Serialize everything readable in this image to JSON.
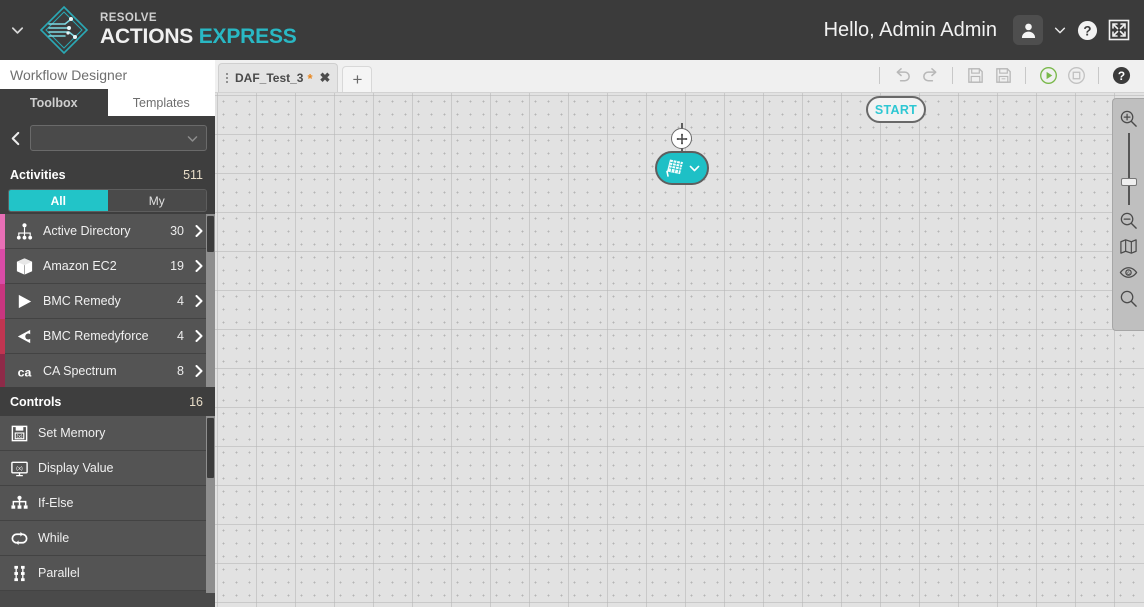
{
  "header": {
    "caret_icon": "chevron-down-icon",
    "brand": {
      "mark_icon": "resolve-diamond-logo",
      "line1": "RESOLVE",
      "line2_a": "ACTIONS",
      "line2_b": "EXPRESS"
    },
    "greeting": "Hello, Admin Admin",
    "avatar_icon": "user-icon",
    "avatar_caret_icon": "chevron-down-icon",
    "help_icon": "help-circle-icon",
    "fullscreen_icon": "fullscreen-expand-icon",
    "bg_color": "#3b3b3b",
    "accent_color": "#29b8c4"
  },
  "left_panel": {
    "title": "Workflow Designer",
    "tabs": [
      {
        "label": "Toolbox",
        "active": true
      },
      {
        "label": "Templates",
        "active": false
      }
    ],
    "collapse_icon": "chevron-left-icon",
    "search": {
      "value": "",
      "placeholder": "",
      "chevron_icon": "chevron-down-icon"
    },
    "activities_section": {
      "title": "Activities",
      "count": "511",
      "filters": [
        {
          "label": "All",
          "selected": true
        },
        {
          "label": "My",
          "selected": false
        }
      ],
      "items": [
        {
          "label": "Active Directory",
          "count": "30",
          "icon": "active-directory-icon",
          "swatch": "#e86fb6",
          "arrow_icon": "chevron-right-icon"
        },
        {
          "label": "Amazon EC2",
          "count": "19",
          "icon": "amazon-ec2-box-icon",
          "swatch": "#d94ba6",
          "arrow_icon": "chevron-right-icon"
        },
        {
          "label": "BMC Remedy",
          "count": "4",
          "icon": "bmc-remedy-play-icon",
          "swatch": "#c9357f",
          "arrow_icon": "chevron-right-icon"
        },
        {
          "label": "BMC Remedyforce",
          "count": "4",
          "icon": "bmc-remedyforce-icon",
          "swatch": "#c03551",
          "arrow_icon": "chevron-right-icon"
        },
        {
          "label": "CA Spectrum",
          "count": "8",
          "icon": "ca-spectrum-icon",
          "swatch": "#8e2a48",
          "arrow_icon": "chevron-right-icon"
        }
      ]
    },
    "controls_section": {
      "title": "Controls",
      "count": "16",
      "items": [
        {
          "label": "Set Memory",
          "icon": "set-memory-icon"
        },
        {
          "label": "Display Value",
          "icon": "display-value-icon"
        },
        {
          "label": "If-Else",
          "icon": "if-else-icon"
        },
        {
          "label": "While",
          "icon": "while-loop-icon"
        },
        {
          "label": "Parallel",
          "icon": "parallel-icon"
        }
      ]
    }
  },
  "topbar": {
    "document_tab": {
      "grip_icon": "drag-handle-icon",
      "name": "DAF_Test_3",
      "dirty_marker": "*",
      "close_icon": "close-icon",
      "close_glyph": "✖"
    },
    "new_tab_label": "+",
    "toolbar_buttons": [
      {
        "name": "undo-button",
        "icon": "undo-arrow-icon"
      },
      {
        "name": "redo-button",
        "icon": "redo-arrow-icon"
      },
      {
        "name": "save-button",
        "icon": "save-floppy-icon"
      },
      {
        "name": "save-as-button",
        "icon": "save-as-floppy-icon"
      },
      {
        "name": "run-button",
        "icon": "play-circle-icon"
      },
      {
        "name": "stop-button",
        "icon": "stop-circle-icon"
      },
      {
        "name": "help-button",
        "icon": "help-circle-icon"
      }
    ]
  },
  "canvas": {
    "start_node_label": "START",
    "start_node_text_color": "#2ec7d3",
    "add_node_icon": "add-node-icon",
    "activity_node": {
      "icon": "network-flag-icon",
      "chevron_icon": "chevron-down-icon",
      "color": "#1ec0c6"
    },
    "zoom_panel": {
      "zoom_in_icon": "zoom-in-icon",
      "slider_name": "zoom-slider",
      "zoom_out_icon": "zoom-out-icon",
      "map_icon": "map-overview-icon",
      "eye_icon": "eye-preview-icon",
      "search_icon": "search-magnifier-icon"
    }
  }
}
